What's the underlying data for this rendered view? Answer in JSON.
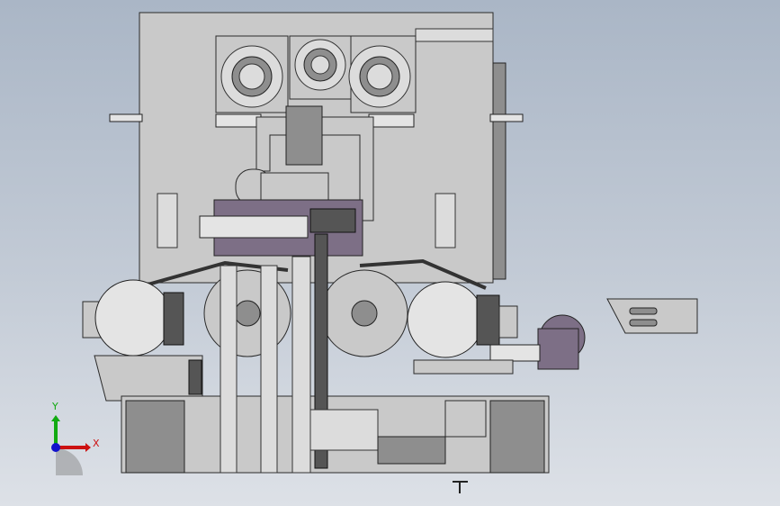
{
  "viewport": {
    "type": "cad-3d-viewport",
    "view": "front"
  },
  "axis_triad": {
    "x_label": "X",
    "y_label": "Y",
    "x_color": "#cc1111",
    "y_color": "#11aa11",
    "z_color": "#1111cc"
  },
  "colors": {
    "background_top": "#aab6c6",
    "background_bottom": "#dde1e7",
    "part": "#c9c9c9",
    "edge": "#2a2a2a"
  }
}
